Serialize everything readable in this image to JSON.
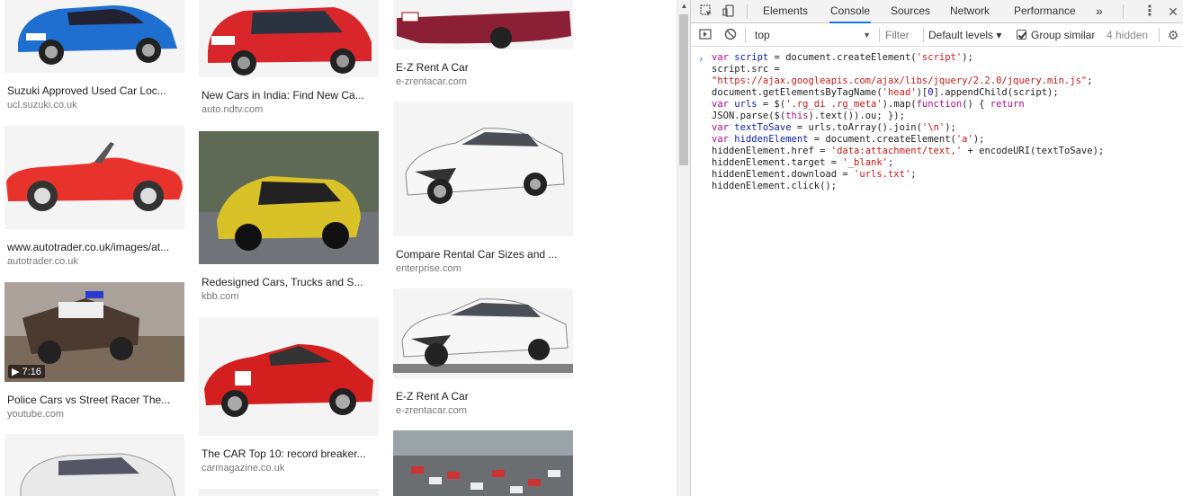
{
  "results": {
    "column1": [
      {
        "caption": "Suzuki Approved Used Car Loc...",
        "source": "ucl.suzuki.co.uk"
      },
      {
        "caption": "www.autotrader.co.uk/images/at...",
        "source": "autotrader.co.uk"
      },
      {
        "caption": "Police Cars vs Street Racer The...",
        "source": "youtube.com",
        "duration": "7:16"
      },
      {
        "caption": "",
        "source": ""
      }
    ],
    "column2": [
      {
        "caption": "New Cars in India: Find New Ca...",
        "source": "auto.ndtv.com"
      },
      {
        "caption": "Redesigned Cars, Trucks and S...",
        "source": "kbb.com"
      },
      {
        "caption": "The CAR Top 10: record breaker...",
        "source": "carmagazine.co.uk"
      }
    ],
    "column3": [
      {
        "caption": "E-Z Rent A Car",
        "source": "e-zrentacar.com"
      },
      {
        "caption": "Compare Rental Car Sizes and ...",
        "source": "enterprise.com"
      },
      {
        "caption": "E-Z Rent A Car",
        "source": "e-zrentacar.com"
      }
    ]
  },
  "devtools": {
    "tabs": [
      "Elements",
      "Console",
      "Sources",
      "Network",
      "Performance"
    ],
    "active_tab": "Console",
    "more_tabs": "»",
    "context": "top",
    "filter_placeholder": "Filter",
    "levels": "Default levels ▾",
    "group_similar": "Group similar",
    "group_similar_checked": true,
    "hidden_count": "4 hidden",
    "prompt": "›",
    "code_lines": [
      "var script = document.createElement('script');",
      "script.src =",
      "\"https://ajax.googleapis.com/ajax/libs/jquery/2.2.0/jquery.min.js\";",
      "document.getElementsByTagName('head')[0].appendChild(script);",
      "var urls = $('.rg_di .rg_meta').map(function() { return",
      "JSON.parse($(this).text()).ou; });",
      "var textToSave = urls.toArray().join('\\n');",
      "var hiddenElement = document.createElement('a');",
      "hiddenElement.href = 'data:attachment/text,' + encodeURI(textToSave);",
      "hiddenElement.target = '_blank';",
      "hiddenElement.download = 'urls.txt';",
      "hiddenElement.click();"
    ]
  },
  "colors": {
    "active_tab_underline": "#1a73e8",
    "keyword": "#aa0d91",
    "string": "#c41a16"
  }
}
